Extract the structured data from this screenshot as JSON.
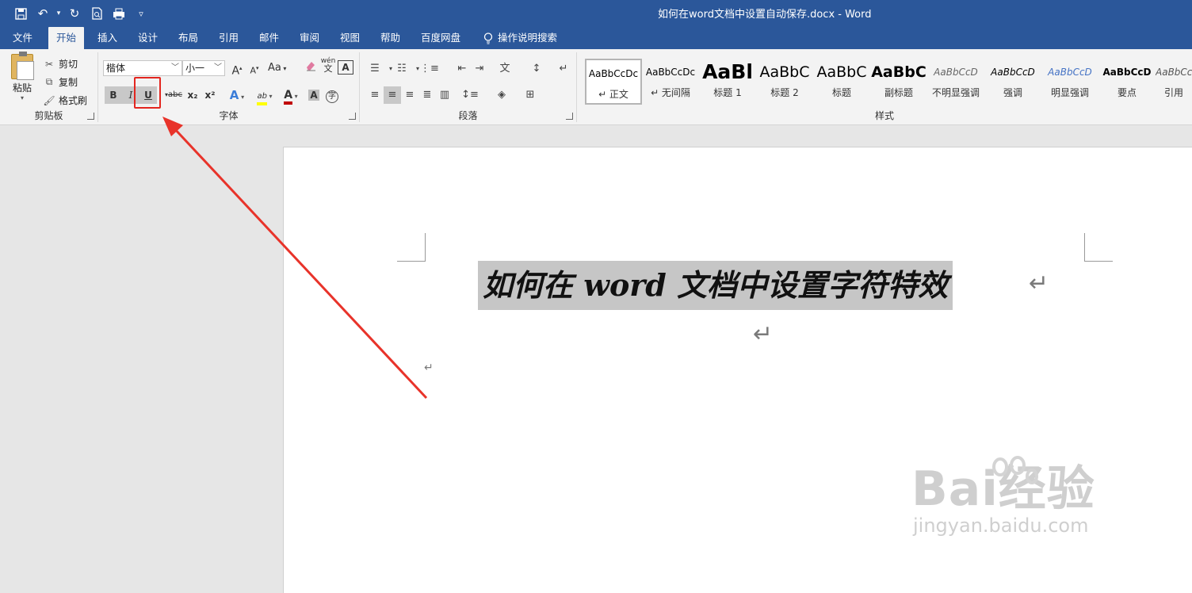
{
  "window": {
    "title": "如何在word文档中设置自动保存.docx  -  Word"
  },
  "qat": {
    "save": "💾",
    "undo": "↶",
    "redo": "↻",
    "preview": "⌕",
    "customize": "▿"
  },
  "tabs": [
    {
      "label": "文件"
    },
    {
      "label": "开始"
    },
    {
      "label": "插入"
    },
    {
      "label": "设计"
    },
    {
      "label": "布局"
    },
    {
      "label": "引用"
    },
    {
      "label": "邮件"
    },
    {
      "label": "审阅"
    },
    {
      "label": "视图"
    },
    {
      "label": "帮助"
    },
    {
      "label": "百度网盘"
    }
  ],
  "tellme": {
    "label": "操作说明搜索"
  },
  "clipboard": {
    "paste": "粘贴",
    "cut": "剪切",
    "copy": "复制",
    "format_painter": "格式刷",
    "group_label": "剪贴板"
  },
  "font": {
    "font_name": "楷体",
    "font_size": "小一",
    "grow": "A",
    "shrink": "A",
    "case": "Aa",
    "bold": "B",
    "italic": "I",
    "underline": "U",
    "strike": "abc",
    "subscript": "x₂",
    "superscript": "x²",
    "text_effect": "A",
    "highlight": "ab",
    "font_color": "A",
    "char_shading": "A",
    "enclose": "字",
    "phonetic": "wén",
    "border": "A",
    "group_label": "字体",
    "highlight_color": "#ffff00",
    "font_color_value": "#c00000"
  },
  "paragraph": {
    "group_label": "段落"
  },
  "styles": {
    "group_label": "样式",
    "items": [
      {
        "sample": "AaBbCcDc",
        "name": "↵ 正文"
      },
      {
        "sample": "AaBbCcDc",
        "name": "↵ 无间隔"
      },
      {
        "sample": "AaBl",
        "name": "标题 1"
      },
      {
        "sample": "AaBbC",
        "name": "标题 2"
      },
      {
        "sample": "AaBbC",
        "name": "标题"
      },
      {
        "sample": "AaBbC",
        "name": "副标题"
      },
      {
        "sample": "AaBbCcD",
        "name": "不明显强调"
      },
      {
        "sample": "AaBbCcD",
        "name": "强调"
      },
      {
        "sample": "AaBbCcD",
        "name": "明显强调"
      },
      {
        "sample": "AaBbCcD",
        "name": "要点"
      },
      {
        "sample": "AaBbCcD",
        "name": "引用"
      }
    ]
  },
  "document": {
    "heading": "如何在 word 文档中设置字符特效",
    "para_mark": "↵"
  },
  "watermark": {
    "brand": "Bai经验",
    "url": "jingyan.baidu.com"
  },
  "colors": {
    "title_bar": "#2b579a",
    "highlight_box": "#e3261f",
    "arrow": "#e8332a",
    "selection": "#c6c6c6"
  }
}
